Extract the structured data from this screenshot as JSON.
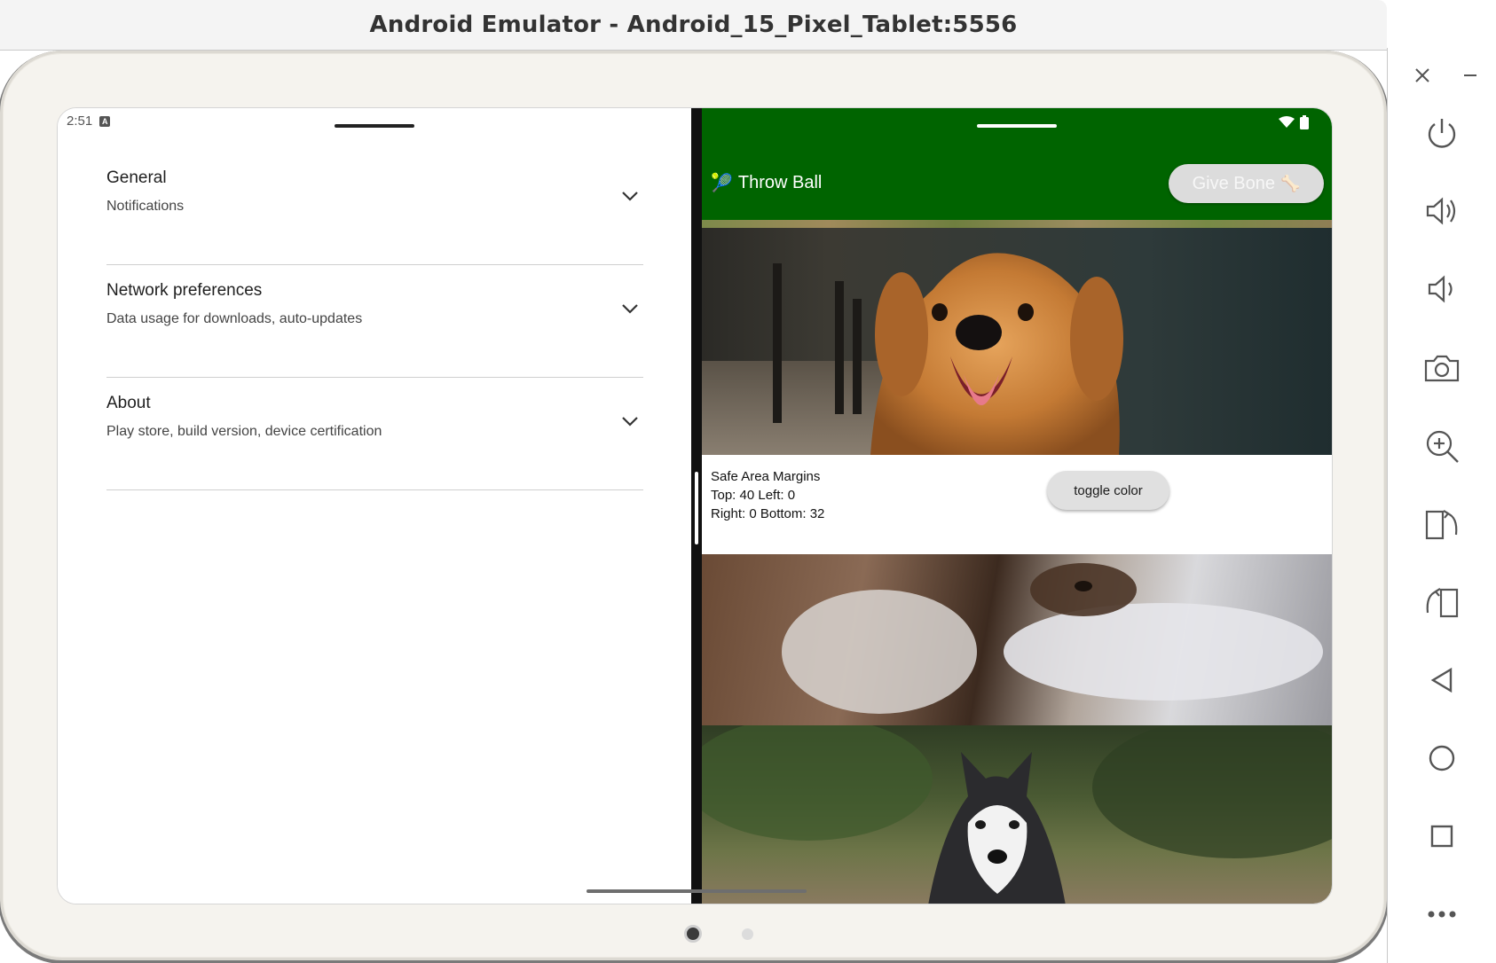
{
  "window": {
    "title": "Android Emulator - Android_15_Pixel_Tablet:5556"
  },
  "status_bar": {
    "time": "2:51",
    "notification_glyph": "A"
  },
  "settings": {
    "items": [
      {
        "title": "General",
        "subtitle": "Notifications",
        "icon": "chevron-down-icon"
      },
      {
        "title": "Network preferences",
        "subtitle": "Data usage for downloads, auto-updates",
        "icon": "chevron-down-icon"
      },
      {
        "title": "About",
        "subtitle": "Play store, build version, device certification",
        "icon": "chevron-down-icon"
      }
    ]
  },
  "app": {
    "bar_color": "#006400",
    "throw_button": {
      "emoji": "🎾",
      "label": "Throw Ball"
    },
    "give_button": {
      "label": "Give Bone",
      "emoji": "🦴"
    },
    "safe_area": {
      "heading": "Safe Area Margins",
      "line1": "Top: 40 Left: 0",
      "line2": "Right: 0 Bottom: 32"
    },
    "toggle_button": {
      "label": "toggle color"
    }
  },
  "pager": {
    "pages": 2,
    "active": 1
  },
  "controls": [
    "close-icon",
    "minimize-icon",
    "power-icon",
    "volume-up-icon",
    "volume-down-icon",
    "camera-icon",
    "zoom-icon",
    "rotate-right-icon",
    "rotate-left-icon",
    "back-icon",
    "home-icon",
    "overview-icon",
    "more-icon"
  ]
}
